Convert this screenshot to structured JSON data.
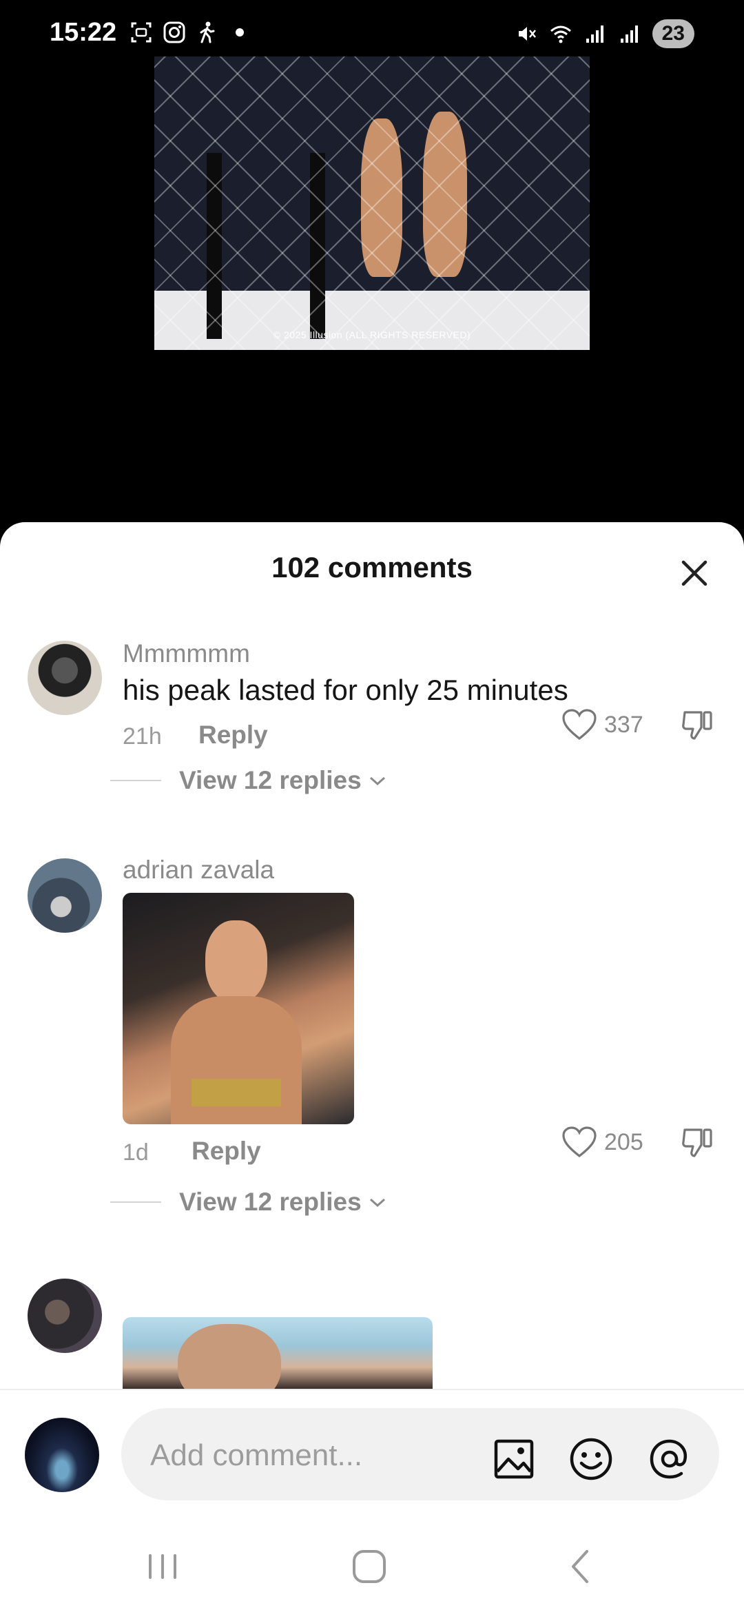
{
  "status_bar": {
    "time": "15:22",
    "battery": "23",
    "icons_left": [
      "screenshot-icon",
      "instagram-icon",
      "walking-icon",
      "dot-icon"
    ],
    "icons_right": [
      "mute-icon",
      "wifi-icon",
      "signal-icon",
      "signal-icon"
    ]
  },
  "video": {
    "watermark": "© 2025 Illusion (ALL RIGHTS RESERVED)"
  },
  "comments_sheet": {
    "title": "102 comments",
    "comments": [
      {
        "user": "Mmmmmm",
        "text": "his peak lasted for only 25 minutes",
        "time": "21h",
        "reply_label": "Reply",
        "likes": "337",
        "view_replies": "View 12 replies"
      },
      {
        "user": "adrian zavala",
        "text": "",
        "time": "1d",
        "reply_label": "Reply",
        "likes": "205",
        "view_replies": "View 12 replies"
      }
    ]
  },
  "input": {
    "placeholder": "Add comment..."
  },
  "colors": {
    "secondary_text": "#8a8a8a",
    "primary_text": "#161616",
    "input_bg": "#f1f1f2"
  }
}
